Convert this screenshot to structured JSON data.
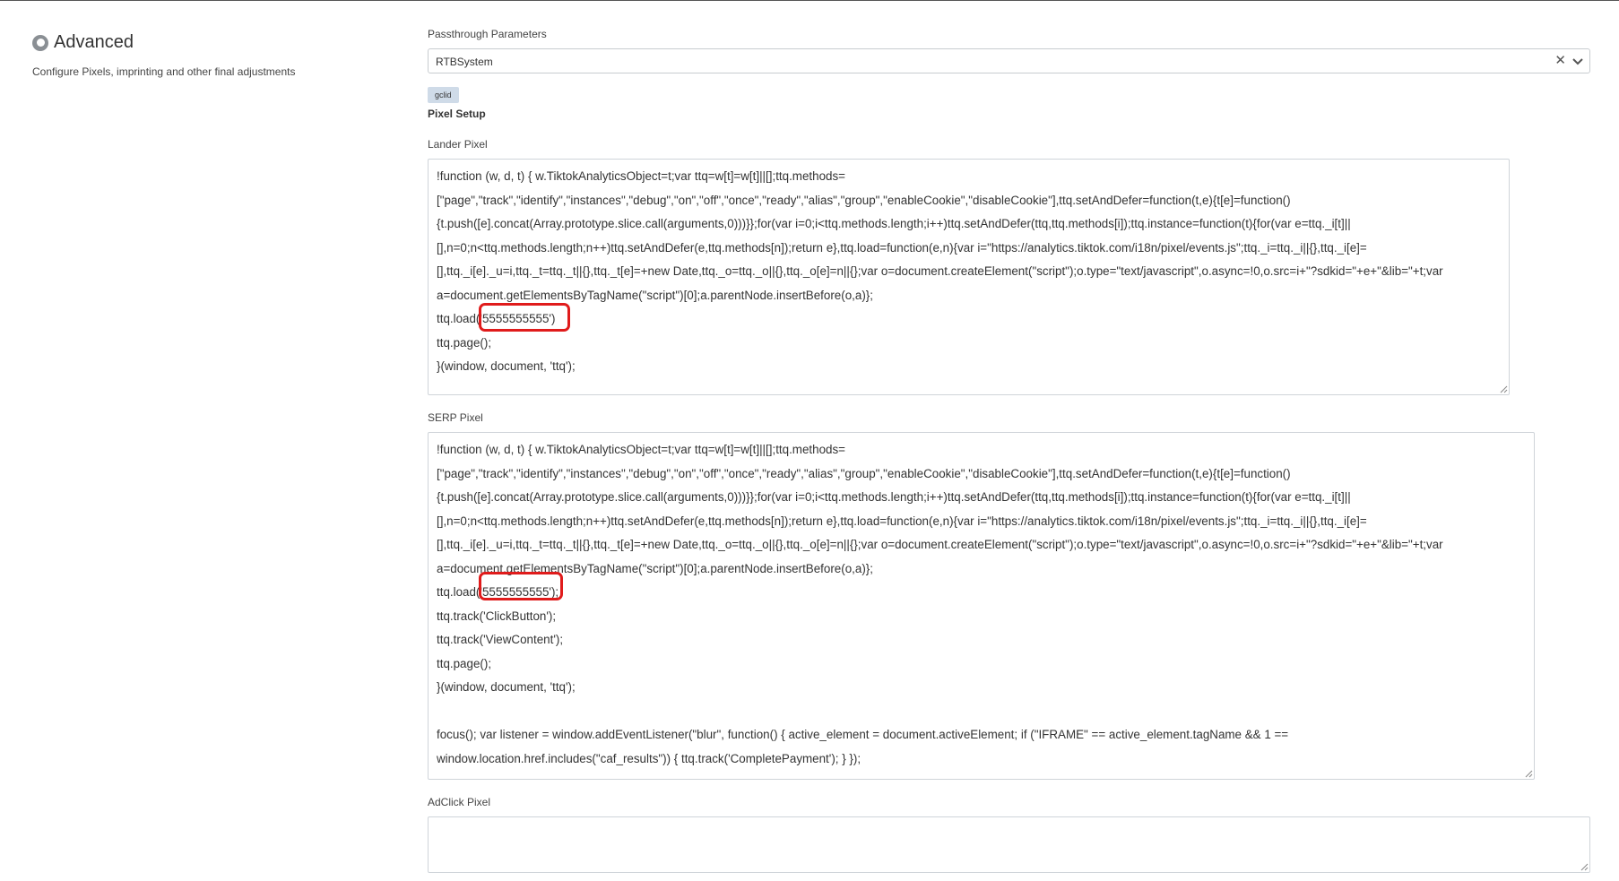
{
  "advanced": {
    "title": "Advanced",
    "description": "Configure Pixels, imprinting and other final adjustments"
  },
  "passthrough": {
    "label": "Passthrough Parameters",
    "selected": "RTBSystem",
    "clear_icon": "close-icon",
    "dropdown_icon": "chevron-down-icon",
    "tag": "gclid"
  },
  "pixel_setup": {
    "heading": "Pixel Setup",
    "lander": {
      "label": "Lander Pixel",
      "lines": [
        "!function (w, d, t) { w.TiktokAnalyticsObject=t;var ttq=w[t]=w[t]||[];ttq.methods=",
        "[\"page\",\"track\",\"identify\",\"instances\",\"debug\",\"on\",\"off\",\"once\",\"ready\",\"alias\",\"group\",\"enableCookie\",\"disableCookie\"],ttq.setAndDefer=function(t,e){t[e]=function()",
        "{t.push([e].concat(Array.prototype.slice.call(arguments,0)))}};for(var i=0;i<ttq.methods.length;i++)ttq.setAndDefer(ttq,ttq.methods[i]);ttq.instance=function(t){for(var e=ttq._i[t]||",
        "[],n=0;n<ttq.methods.length;n++)ttq.setAndDefer(e,ttq.methods[n]);return e},ttq.load=function(e,n){var i=\"https://analytics.tiktok.com/i18n/pixel/events.js\";ttq._i=ttq._i||{},ttq._i[e]=",
        "[],ttq._i[e]._u=i,ttq._t=ttq._t||{},ttq._t[e]=+new Date,ttq._o=ttq._o||{},ttq._o[e]=n||{};var o=document.createElement(\"script\");o.type=\"text/javascript\",o.async=!0,o.src=i+\"?sdkid=\"+e+\"&lib=\"+t;var",
        "a=document.getElementsByTagName(\"script\")[0];a.parentNode.insertBefore(o,a)};",
        "ttq.load('5555555555')",
        "ttq.page();",
        "}(window, document, 'ttq');"
      ]
    },
    "serp": {
      "label": "SERP Pixel",
      "lines": [
        "!function (w, d, t) { w.TiktokAnalyticsObject=t;var ttq=w[t]=w[t]||[];ttq.methods=",
        "[\"page\",\"track\",\"identify\",\"instances\",\"debug\",\"on\",\"off\",\"once\",\"ready\",\"alias\",\"group\",\"enableCookie\",\"disableCookie\"],ttq.setAndDefer=function(t,e){t[e]=function()",
        "{t.push([e].concat(Array.prototype.slice.call(arguments,0)))}};for(var i=0;i<ttq.methods.length;i++)ttq.setAndDefer(ttq,ttq.methods[i]);ttq.instance=function(t){for(var e=ttq._i[t]||",
        "[],n=0;n<ttq.methods.length;n++)ttq.setAndDefer(e,ttq.methods[n]);return e},ttq.load=function(e,n){var i=\"https://analytics.tiktok.com/i18n/pixel/events.js\";ttq._i=ttq._i||{},ttq._i[e]=",
        "[],ttq._i[e]._u=i,ttq._t=ttq._t||{},ttq._t[e]=+new Date,ttq._o=ttq._o||{},ttq._o[e]=n||{};var o=document.createElement(\"script\");o.type=\"text/javascript\",o.async=!0,o.src=i+\"?sdkid=\"+e+\"&lib=\"+t;var",
        "a=document.getElementsByTagName(\"script\")[0];a.parentNode.insertBefore(o,a)};",
        "ttq.load('5555555555');",
        "ttq.track('ClickButton');",
        "ttq.track('ViewContent');",
        "ttq.page();",
        "}(window, document, 'ttq');",
        "",
        "focus(); var listener = window.addEventListener(\"blur\", function() { active_element = document.activeElement; if (\"IFRAME\" == active_element.tagName && 1 ==",
        "window.location.href.includes(\"caf_results\")) { ttq.track('CompletePayment'); } });"
      ]
    },
    "adclick": {
      "label": "AdClick Pixel",
      "value": ""
    }
  },
  "colors": {
    "highlight": "#e01b1b",
    "tag_bg": "#cfdbe8"
  }
}
